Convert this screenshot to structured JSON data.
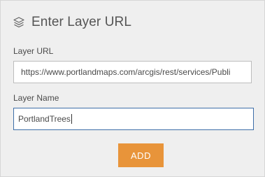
{
  "dialog": {
    "title": "Enter Layer URL",
    "icon": "layers-icon"
  },
  "form": {
    "url_label": "Layer URL",
    "url_value": "https://www.portlandmaps.com/arcgis/rest/services/Publi",
    "name_label": "Layer Name",
    "name_value": "PortlandTrees"
  },
  "actions": {
    "add_label": "ADD"
  },
  "colors": {
    "accent": "#e8943a",
    "focus_border": "#3d6ea8",
    "panel_bg": "#efefef"
  }
}
